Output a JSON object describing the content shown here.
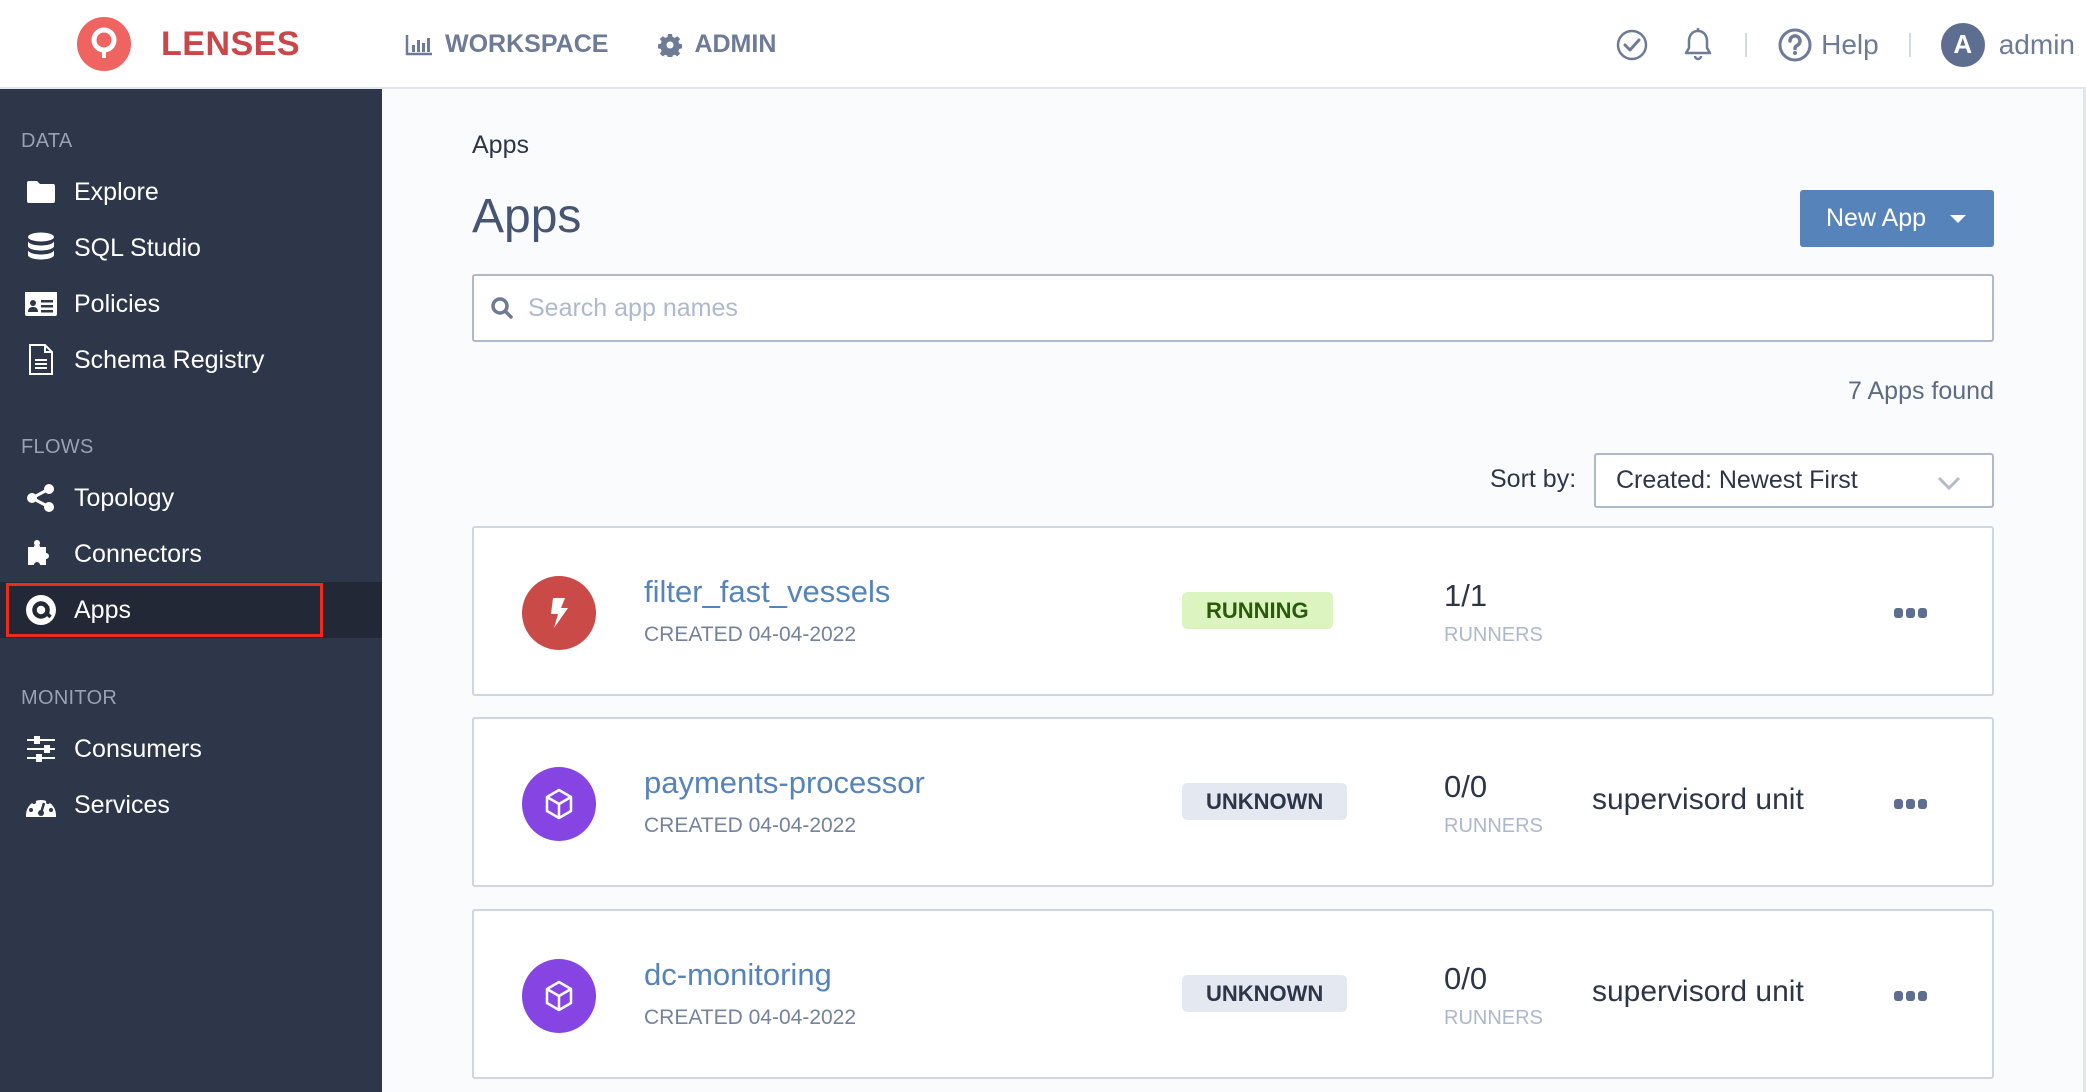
{
  "header": {
    "brand": "LENSES",
    "nav": [
      {
        "label": "WORKSPACE",
        "icon": "bar-chart-icon"
      },
      {
        "label": "ADMIN",
        "icon": "gear-icon"
      }
    ],
    "help_label": "Help",
    "user": {
      "avatar_initial": "A",
      "name": "admin"
    }
  },
  "sidebar": {
    "sections": [
      {
        "title": "DATA",
        "items": [
          {
            "label": "Explore",
            "icon": "folder-icon"
          },
          {
            "label": "SQL Studio",
            "icon": "database-icon"
          },
          {
            "label": "Policies",
            "icon": "id-card-icon"
          },
          {
            "label": "Schema Registry",
            "icon": "document-icon"
          }
        ]
      },
      {
        "title": "FLOWS",
        "items": [
          {
            "label": "Topology",
            "icon": "share-nodes-icon"
          },
          {
            "label": "Connectors",
            "icon": "puzzle-icon"
          },
          {
            "label": "Apps",
            "icon": "apps-at-icon",
            "active": true
          }
        ]
      },
      {
        "title": "MONITOR",
        "items": [
          {
            "label": "Consumers",
            "icon": "sliders-icon"
          },
          {
            "label": "Services",
            "icon": "dashboard-gauge-icon"
          }
        ]
      }
    ]
  },
  "main": {
    "breadcrumb": "Apps",
    "title": "Apps",
    "new_app_label": "New App",
    "search_placeholder": "Search app names",
    "search_value": "",
    "found_text": "7 Apps found",
    "sort_label": "Sort by:",
    "sort_value": "Created: Newest First",
    "apps": [
      {
        "name": "filter_fast_vessels",
        "created": "CREATED 04-04-2022",
        "status": "RUNNING",
        "runners": "1/1",
        "runners_label": "RUNNERS",
        "unit": "",
        "icon": "lightning-bolt-icon",
        "icon_color": "#c94a47"
      },
      {
        "name": "payments-processor",
        "created": "CREATED 04-04-2022",
        "status": "UNKNOWN",
        "runners": "0/0",
        "runners_label": "RUNNERS",
        "unit": "supervisord unit",
        "icon": "cube-icon",
        "icon_color": "#8645e3"
      },
      {
        "name": "dc-monitoring",
        "created": "CREATED 04-04-2022",
        "status": "UNKNOWN",
        "runners": "0/0",
        "runners_label": "RUNNERS",
        "unit": "supervisord unit",
        "icon": "cube-icon",
        "icon_color": "#8645e3"
      }
    ]
  },
  "colors": {
    "brand": "#ef6461",
    "sidebar_bg": "#2e3649",
    "primary_button": "#5583ba",
    "highlight_outline": "#ea2c1f"
  }
}
